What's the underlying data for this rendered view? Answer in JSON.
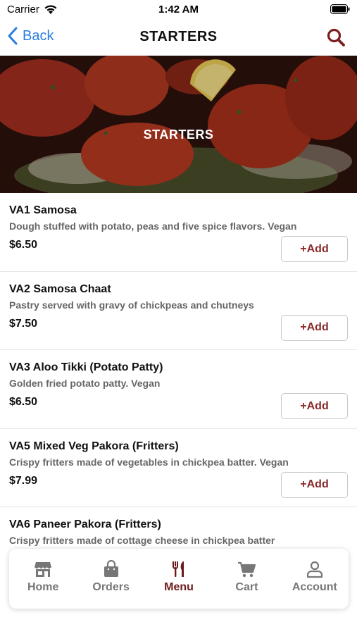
{
  "status_bar": {
    "carrier": "Carrier",
    "time": "1:42 AM"
  },
  "nav": {
    "back_label": "Back",
    "title": "STARTERS"
  },
  "hero": {
    "title": "STARTERS"
  },
  "menu": {
    "add_label": "+Add",
    "items": [
      {
        "name": "VA1 Samosa",
        "description": "Dough stuffed with potato, peas and five spice flavors. Vegan",
        "price": "$6.50"
      },
      {
        "name": "VA2 Samosa Chaat",
        "description": "Pastry served with gravy of chickpeas and chutneys",
        "price": "$7.50"
      },
      {
        "name": "VA3 Aloo Tikki (Potato Patty)",
        "description": "Golden fried potato patty. Vegan",
        "price": "$6.50"
      },
      {
        "name": "VA5 Mixed Veg Pakora (Fritters)",
        "description": "Crispy fritters made of vegetables in chickpea batter. Vegan",
        "price": "$7.99"
      },
      {
        "name": "VA6 Paneer Pakora (Fritters)",
        "description": "Crispy fritters made of cottage cheese in chickpea batter",
        "price": ""
      }
    ]
  },
  "tabs": [
    {
      "label": "Home",
      "icon": "store-icon",
      "active": false
    },
    {
      "label": "Orders",
      "icon": "bag-icon",
      "active": false
    },
    {
      "label": "Menu",
      "icon": "fork-knife-icon",
      "active": true
    },
    {
      "label": "Cart",
      "icon": "cart-icon",
      "active": false
    },
    {
      "label": "Account",
      "icon": "user-icon",
      "active": false
    }
  ],
  "colors": {
    "accent": "#8a2a2a",
    "link": "#2a7de1",
    "active_tab": "#6b1a1a",
    "inactive_tab": "#777777"
  }
}
